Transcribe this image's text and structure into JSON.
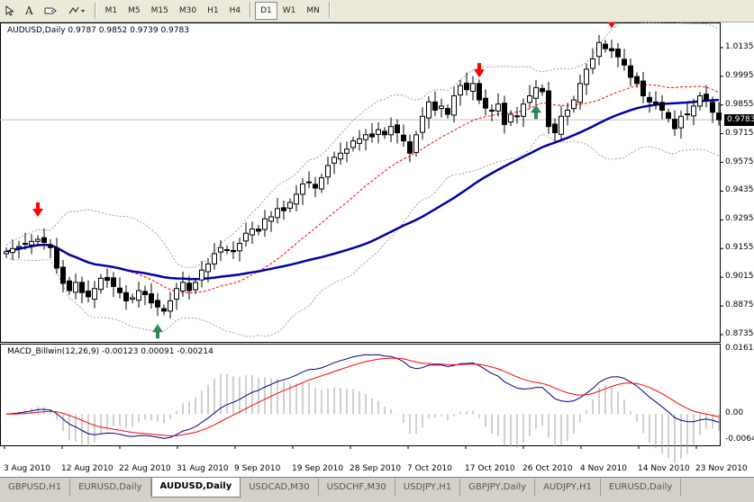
{
  "toolbar": {
    "icons": [
      "cursor-icon",
      "text-icon",
      "label-icon",
      "shapes-dropdown-icon"
    ],
    "timeframes": [
      "M1",
      "M5",
      "M15",
      "M30",
      "H1",
      "H4",
      "D1",
      "W1",
      "MN"
    ],
    "active_timeframe": "D1"
  },
  "chart": {
    "symbol_line": "AUDUSD,Daily  0.9787 0.9852 0.9739 0.9783",
    "current_price": "0.9783",
    "price_ticks": [
      "1.0135",
      "0.9995",
      "0.9855",
      "0.9715",
      "0.9575",
      "0.9435",
      "0.9295",
      "0.9155",
      "0.9015",
      "0.8875",
      "0.8735"
    ],
    "date_ticks": [
      "3 Aug 2010",
      "12 Aug 2010",
      "22 Aug 2010",
      "31 Aug 2010",
      "9 Sep 2010",
      "19 Sep 2010",
      "28 Sep 2010",
      "7 Oct 2010",
      "17 Oct 2010",
      "26 Oct 2010",
      "4 Nov 2010",
      "14 Nov 2010",
      "23 Nov 2010"
    ],
    "colors": {
      "bull": "#ffffff",
      "bear": "#000000",
      "ma_slow": "#0000aa",
      "ma_fast": "#ff0000",
      "bands": "#a0a0a0",
      "arrow_up": "#2e8b57",
      "arrow_down": "#ff0000"
    }
  },
  "indicator": {
    "title": "MACD_Billwin(12,26,9) -0.00123 0.00091 -0.00214",
    "ticks": [
      "0.01618",
      "0.00",
      "-0.00641"
    ],
    "colors": {
      "macd": "#00008b",
      "signal": "#ff0000",
      "histogram": "#a0a0a0"
    }
  },
  "chart_data": {
    "type": "candlestick",
    "symbol": "AUDUSD",
    "timeframe": "Daily",
    "last_bar": {
      "open": 0.9787,
      "high": 0.9852,
      "low": 0.9739,
      "close": 0.9783
    },
    "ylim": [
      0.8735,
      1.0205
    ],
    "y_ticks": [
      1.0135,
      0.9995,
      0.9855,
      0.9715,
      0.9575,
      0.9435,
      0.9295,
      0.9155,
      0.9015,
      0.8875,
      0.8735
    ],
    "x_tick_labels": [
      "3 Aug 2010",
      "12 Aug 2010",
      "22 Aug 2010",
      "31 Aug 2010",
      "9 Sep 2010",
      "19 Sep 2010",
      "28 Sep 2010",
      "7 Oct 2010",
      "17 Oct 2010",
      "26 Oct 2010",
      "4 Nov 2010",
      "14 Nov 2010",
      "23 Nov 2010"
    ],
    "closes": [
      0.914,
      0.9155,
      0.9165,
      0.918,
      0.919,
      0.92,
      0.9185,
      0.916,
      0.906,
      0.8985,
      0.895,
      0.899,
      0.894,
      0.892,
      0.896,
      0.901,
      0.9,
      0.897,
      0.894,
      0.89,
      0.8915,
      0.895,
      0.893,
      0.889,
      0.887,
      0.885,
      0.89,
      0.896,
      0.899,
      0.895,
      0.899,
      0.905,
      0.908,
      0.913,
      0.916,
      0.915,
      0.914,
      0.918,
      0.923,
      0.925,
      0.924,
      0.93,
      0.931,
      0.935,
      0.934,
      0.938,
      0.942,
      0.947,
      0.948,
      0.945,
      0.95,
      0.956,
      0.96,
      0.962,
      0.964,
      0.968,
      0.969,
      0.971,
      0.97,
      0.9735,
      0.971,
      0.975,
      0.972,
      0.968,
      0.962,
      0.971,
      0.98,
      0.987,
      0.983,
      0.985,
      0.981,
      0.99,
      0.995,
      0.993,
      0.996,
      0.988,
      0.984,
      0.983,
      0.986,
      0.976,
      0.981,
      0.98,
      0.986,
      0.99,
      0.994,
      0.992,
      0.975,
      0.972,
      0.98,
      0.983,
      0.988,
      0.996,
      1.003,
      1.008,
      1.016,
      1.013,
      1.012,
      1.009,
      1.005,
      0.999,
      0.996,
      0.99,
      0.987,
      0.986,
      0.983,
      0.979,
      0.974,
      0.98,
      0.981,
      0.985,
      0.99,
      0.988,
      0.982,
      0.9783
    ],
    "buy_signal_bars": [
      24,
      84
    ],
    "sell_signal_bars": [
      5,
      75,
      96
    ],
    "indicator": {
      "name": "MACD_Billwin(12,26,9)",
      "values": {
        "macd": -0.00123,
        "signal": 0.00091,
        "histogram": -0.00214
      },
      "ylim": [
        -0.00641,
        0.01618
      ]
    }
  }
}
